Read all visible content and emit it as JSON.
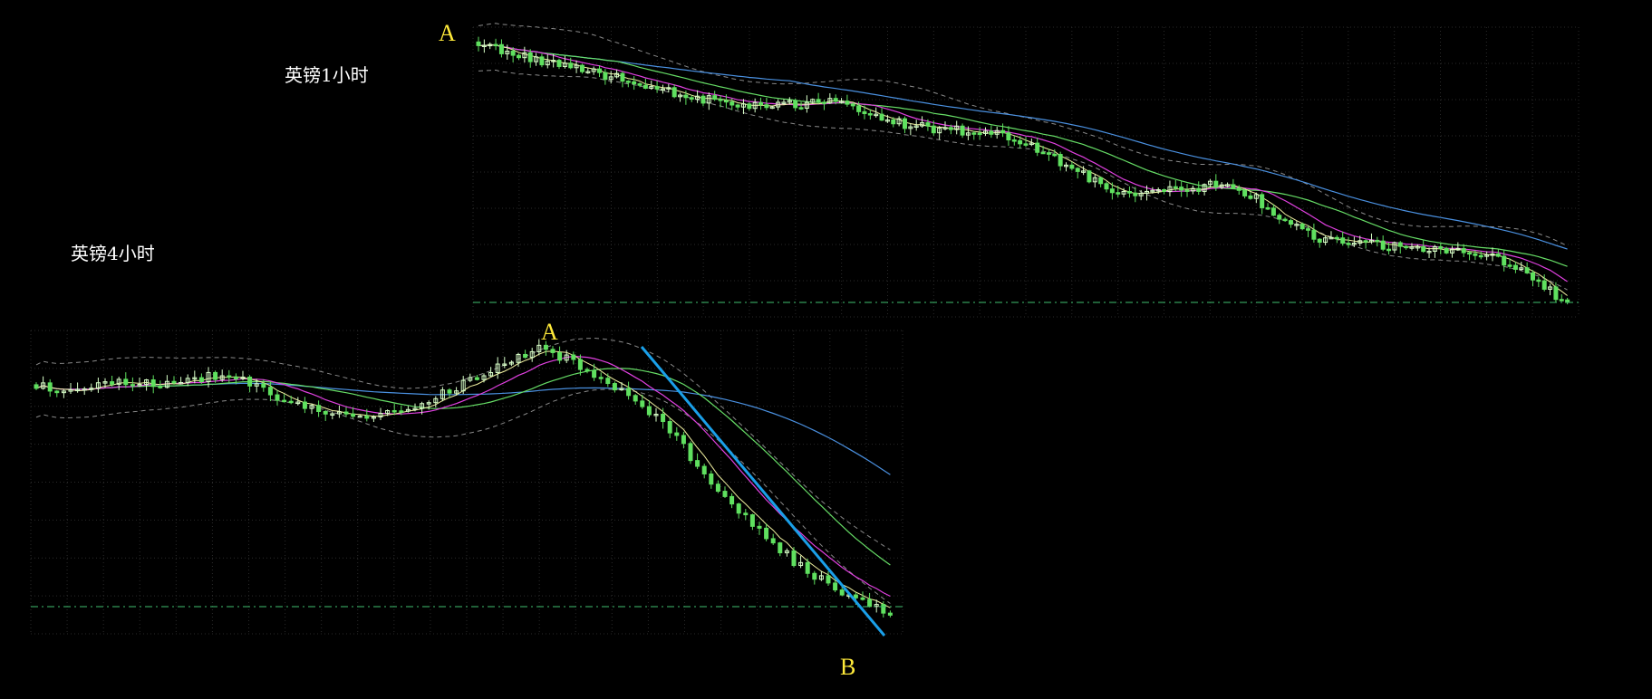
{
  "colors": {
    "background": "#000000",
    "grid": "#2a2a2a",
    "candle_up": "#d8ffc8",
    "candle_down": "#5fe05f",
    "ma_fast": "#f0f0a0",
    "ma_mid": "#e040e0",
    "ma_slow": "#66dd66",
    "ma_long": "#4a90e0",
    "bollinger": "#8a8a8a",
    "support_line": "#3fbf6f",
    "trend_line": "#1a9fe8",
    "marker_text": "#ffea3a",
    "title_text": "#ffffff"
  },
  "chart_data": [
    {
      "type": "candlestick",
      "title": "英镑1小时",
      "markers": [
        "A"
      ],
      "legend": "none",
      "grid": true,
      "series": [
        {
          "kind": "candles"
        },
        {
          "kind": "moving-average"
        },
        {
          "kind": "moving-average"
        },
        {
          "kind": "moving-average"
        },
        {
          "kind": "moving-average"
        },
        {
          "kind": "bollinger-bands"
        }
      ],
      "shape": {
        "trend": "downtrend",
        "close_path": [
          1.0,
          0.96,
          0.93,
          0.9,
          0.87,
          0.84,
          0.8,
          0.78,
          0.76,
          0.77,
          0.78,
          0.75,
          0.7,
          0.68,
          0.67,
          0.66,
          0.6,
          0.52,
          0.45,
          0.44,
          0.45,
          0.47,
          0.43,
          0.33,
          0.26,
          0.25,
          0.24,
          0.23,
          0.22,
          0.2,
          0.12,
          0.02
        ]
      }
    },
    {
      "type": "candlestick",
      "title": "英镑4小时",
      "markers": [
        "A",
        "B"
      ],
      "legend": "none",
      "grid": true,
      "series": [
        {
          "kind": "candles"
        },
        {
          "kind": "moving-average"
        },
        {
          "kind": "moving-average"
        },
        {
          "kind": "moving-average"
        },
        {
          "kind": "moving-average"
        },
        {
          "kind": "bollinger-bands"
        },
        {
          "kind": "trend-line"
        }
      ],
      "shape": {
        "trend": "rise-then-sharp-drop",
        "close_path": [
          0.86,
          0.84,
          0.86,
          0.88,
          0.87,
          0.89,
          0.9,
          0.86,
          0.8,
          0.76,
          0.74,
          0.75,
          0.78,
          0.84,
          0.9,
          0.96,
          1.0,
          0.95,
          0.87,
          0.8,
          0.7,
          0.55,
          0.42,
          0.3,
          0.2,
          0.12,
          0.06,
          0.0
        ]
      }
    }
  ]
}
